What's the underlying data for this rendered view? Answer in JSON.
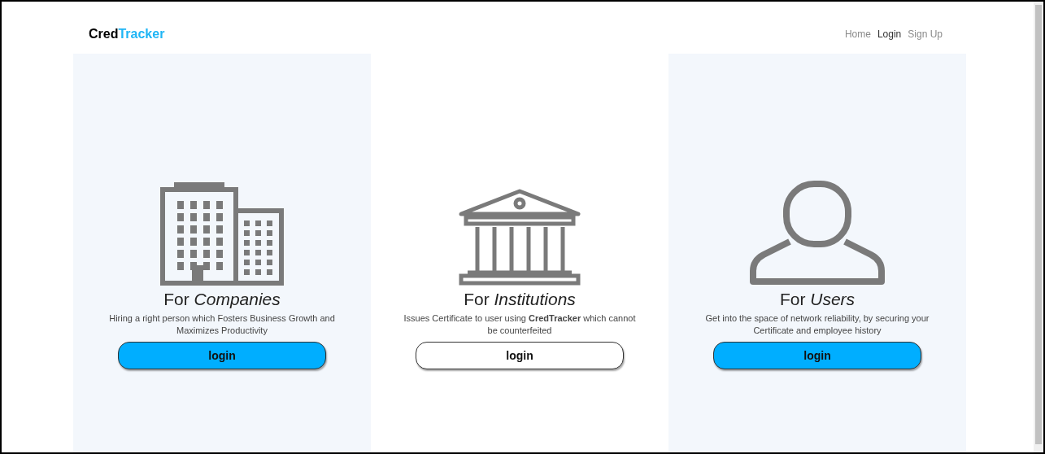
{
  "logo": {
    "part_1": "Cred",
    "part_2": "Tracker"
  },
  "nav": [
    {
      "label": "Home",
      "selected": false
    },
    {
      "label": "Login",
      "selected": true
    },
    {
      "label": "Sign Up",
      "selected": false
    }
  ],
  "cards": [
    {
      "kind": "companies",
      "shaded": true,
      "title": "For *Companies*",
      "description": "Hiring a right person which Fosters Business Growth and Maximizes Productivity",
      "button": {
        "label": "login",
        "primary": true
      }
    },
    {
      "kind": "institutions",
      "shaded": false,
      "title": "For *Institutions*",
      "description": "Issues Certificate to user using **CredTracker** which cannot be counterfeited",
      "button": {
        "label": "login",
        "primary": false
      }
    },
    {
      "kind": "users",
      "shaded": true,
      "title": "For *Users*",
      "description": "Get into the space of network reliability, by securing your Certificate and employee history",
      "button": {
        "label": "login",
        "primary": true
      }
    }
  ]
}
